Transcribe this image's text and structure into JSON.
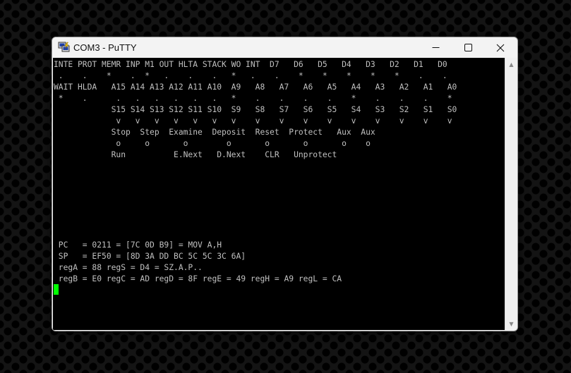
{
  "window": {
    "title": "COM3 - PuTTY",
    "icon": "putty-icon"
  },
  "terminal": {
    "lines": [
      "INTE PROT MEMR INP M1 OUT HLTA STACK WO INT  D7   D6   D5   D4   D3   D2   D1   D0",
      " .    .    *    .  *   .    .    .   *   .    .    *    *    *    *    *    .    .",
      "WAIT HLDA   A15 A14 A13 A12 A11 A10  A9   A8   A7   A6   A5   A4   A3   A2   A1   A0",
      " *    .      .   .   .   .   .   .   *    .    .    .    .    *    .    .    .    *",
      "            S15 S14 S13 S12 S11 S10  S9   S8   S7   S6   S5   S4   S3   S2   S1   S0",
      "             v   v   v   v   v   v   v    v    v    v    v    v    v    v    v    v",
      "            Stop  Step  Examine  Deposit  Reset  Protect   Aux  Aux",
      "             o     o       o        o       o       o       o    o",
      "            Run          E.Next   D.Next    CLR   Unprotect",
      "",
      "",
      "",
      "",
      "",
      "",
      "",
      " PC   = 0211 = [7C 0D B9] = MOV A,H",
      " SP   = EF50 = [8D 3A DD BC 5C 5C 3C 6A]",
      " regA = 88 regS = D4 = SZ.A.P..",
      " regB = E0 regC = AD regD = 8F regE = 49 regH = A9 regL = CA"
    ]
  },
  "colors": {
    "terminal_bg": "#000000",
    "terminal_fg": "#c0c0c0",
    "cursor": "#00ff00"
  }
}
